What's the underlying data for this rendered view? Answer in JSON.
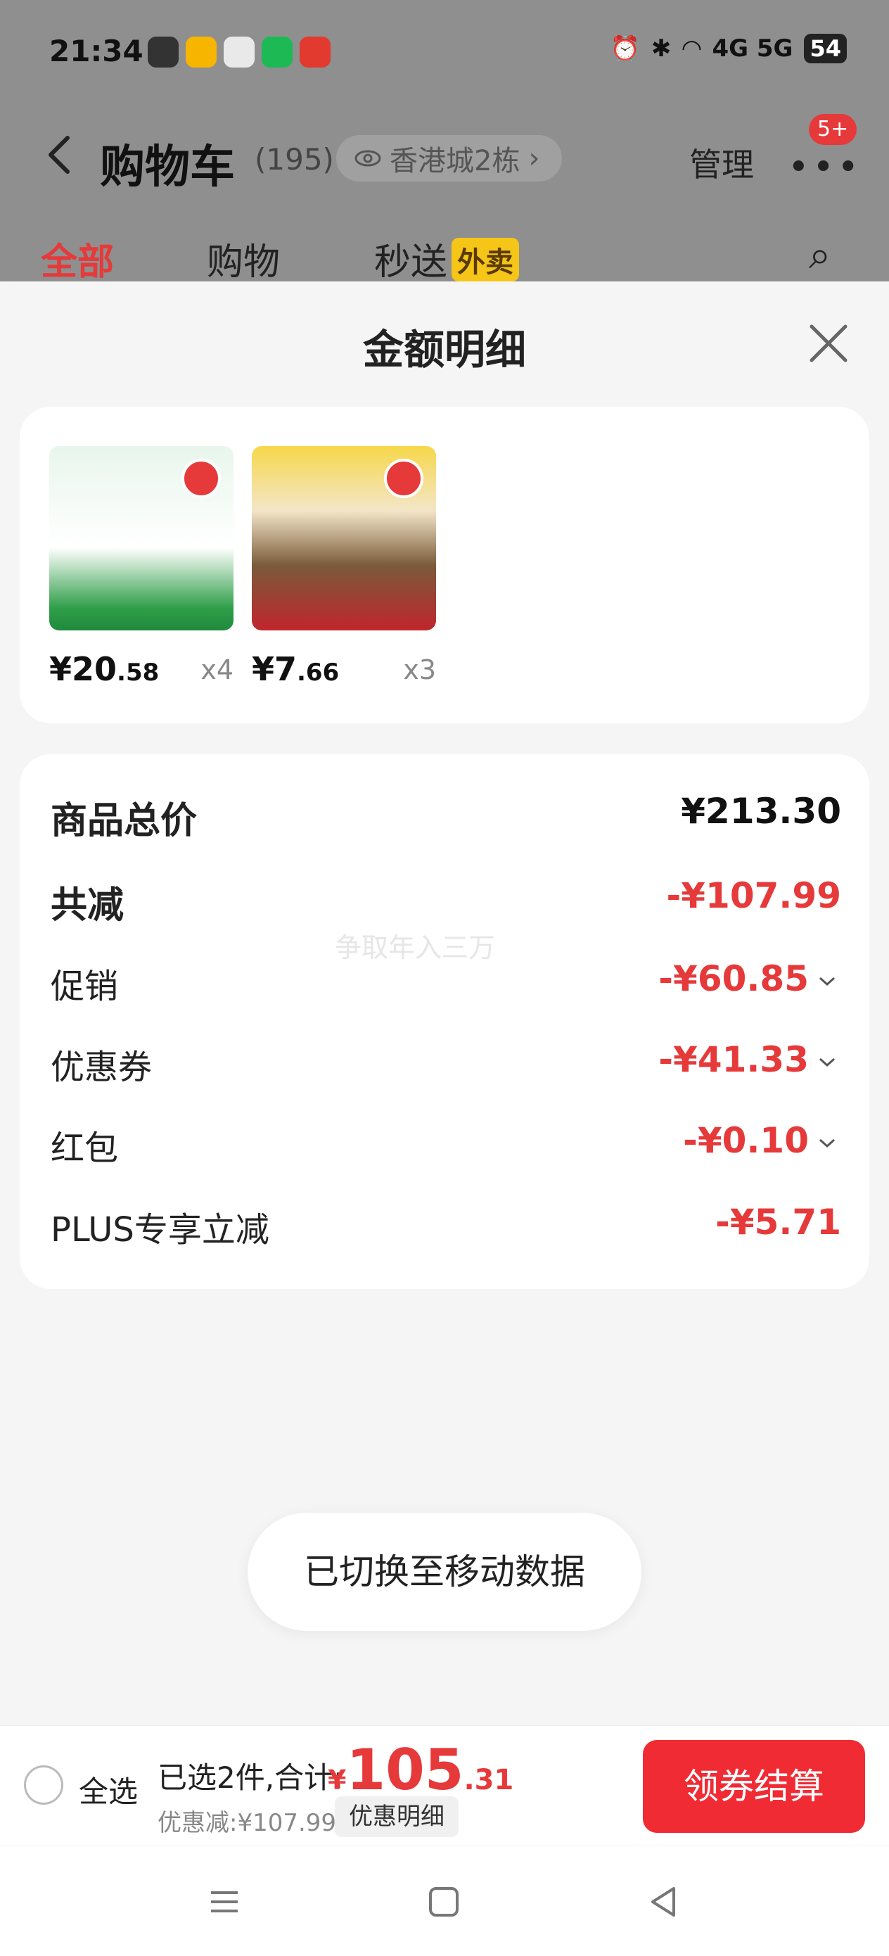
{
  "status_bar": {
    "time": "21:34",
    "network": "4G 5G",
    "battery": "54"
  },
  "nav": {
    "title": "购物车",
    "count": "(195)",
    "location": "香港城2栋",
    "manage": "管理",
    "badge": "5+"
  },
  "tabs": [
    {
      "label": "全部"
    },
    {
      "label": "购物"
    },
    {
      "label": "秒送",
      "tag": "外卖"
    }
  ],
  "sheet": {
    "title": "金额明细",
    "products": [
      {
        "price_int": "¥20",
        "price_dec": ".58",
        "qty": "x4"
      },
      {
        "price_int": "¥7",
        "price_dec": ".66",
        "qty": "x3"
      }
    ],
    "summary": {
      "total": {
        "label": "商品总价",
        "value": "¥213.30"
      },
      "reduce": {
        "label": "共减",
        "value": "-¥107.99"
      },
      "items": [
        {
          "label": "促销",
          "value": "-¥60.85"
        },
        {
          "label": "优惠券",
          "value": "-¥41.33"
        },
        {
          "label": "红包",
          "value": "-¥0.10"
        },
        {
          "label": "PLUS专享立减",
          "value": "-¥5.71"
        }
      ]
    },
    "watermark": "争取年入三万"
  },
  "toast": "已切换至移动数据",
  "bottom_bar": {
    "select_all": "全选",
    "selected_info": "已选2件,合计:",
    "total_symbol": "¥",
    "total_int": "105",
    "total_dec": ".31",
    "discount_text": "优惠减:¥107.99",
    "detail_button": "优惠明细",
    "checkout_button": "领券结算"
  },
  "colors": {
    "accent": "#e6393a",
    "checkout": "#f02b34",
    "waimai_tag": "#f5c518"
  }
}
